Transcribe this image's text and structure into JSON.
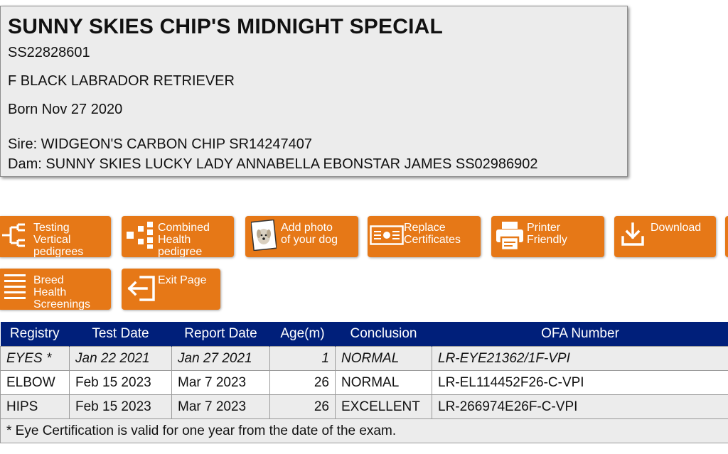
{
  "dog": {
    "name": "SUNNY SKIES CHIP'S MIDNIGHT SPECIAL",
    "registration": "SS22828601",
    "description": "F BLACK LABRADOR RETRIEVER",
    "born": "Born Nov 27 2020",
    "sire": "Sire: WIDGEON'S CARBON CHIP SR14247407",
    "dam": "Dam: SUNNY SKIES LUCKY LADY ANNABELLA EBONSTAR JAMES SS02986902"
  },
  "buttons": {
    "testing_vertical": "Testing\nVertical\npedigrees",
    "combined_health": "Combined\nHealth\npedigree",
    "add_photo": "Add photo\nof your dog",
    "replace_certs": "Replace\nCertificates",
    "printer_friendly": "Printer\nFriendly",
    "download": "Download",
    "breed_health": "Breed\nHealth\nScreenings",
    "exit_page": "Exit Page"
  },
  "table": {
    "headers": [
      "Registry",
      "Test Date",
      "Report Date",
      "Age(m)",
      "Conclusion",
      "OFA Number"
    ],
    "rows": [
      {
        "registry": "EYES *",
        "test_date": "Jan 22 2021",
        "report_date": "Jan 27 2021",
        "age": "1",
        "conclusion": "NORMAL",
        "ofa": "LR-EYE21362/1F-VPI"
      },
      {
        "registry": "ELBOW",
        "test_date": "Feb 15 2023",
        "report_date": "Mar 7 2023",
        "age": "26",
        "conclusion": "NORMAL",
        "ofa": "LR-EL114452F26-C-VPI"
      },
      {
        "registry": "HIPS",
        "test_date": "Feb 15 2023",
        "report_date": "Mar 7 2023",
        "age": "26",
        "conclusion": "EXCELLENT",
        "ofa": "LR-266974E26F-C-VPI"
      }
    ],
    "footnote": "* Eye Certification is valid for one year from the date of the exam."
  },
  "colors": {
    "button_orange": "#e67817",
    "header_navy": "#001f7a",
    "panel_gray": "#ececec"
  }
}
